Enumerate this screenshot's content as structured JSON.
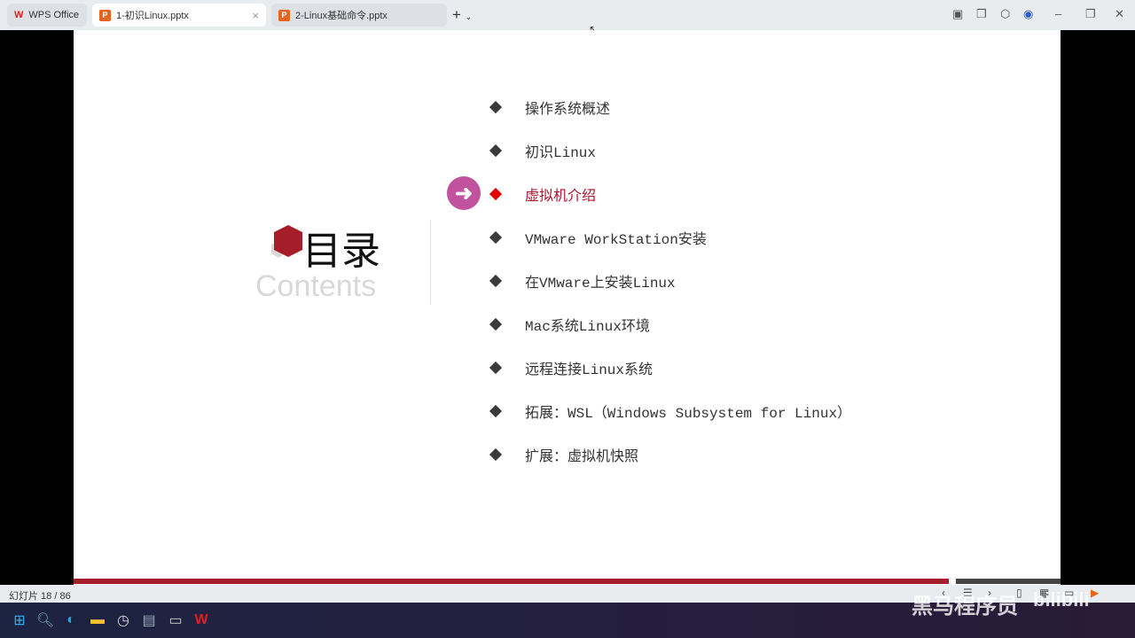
{
  "tabs": [
    {
      "label": "WPS Office"
    },
    {
      "label": "1-初识Linux.pptx"
    },
    {
      "label": "2-Linux基础命令.pptx"
    }
  ],
  "slide": {
    "title_cn": "目录",
    "title_en": "Contents",
    "items": [
      "操作系统概述",
      "初识Linux",
      "虚拟机介绍",
      "VMware WorkStation安装",
      "在VMware上安装Linux",
      "Mac系统Linux环境",
      "远程连接Linux系统",
      "拓展：WSL（Windows Subsystem for Linux）",
      "扩展：虚拟机快照"
    ],
    "active_index": 2
  },
  "status": {
    "slide_counter": "幻灯片 18 / 86"
  },
  "watermark": {
    "text": "黑马程序员",
    "logo": "bilibili"
  },
  "colors": {
    "accent": "#a51d29",
    "active_item": "#b3122a",
    "arrow": "#c0529e"
  }
}
